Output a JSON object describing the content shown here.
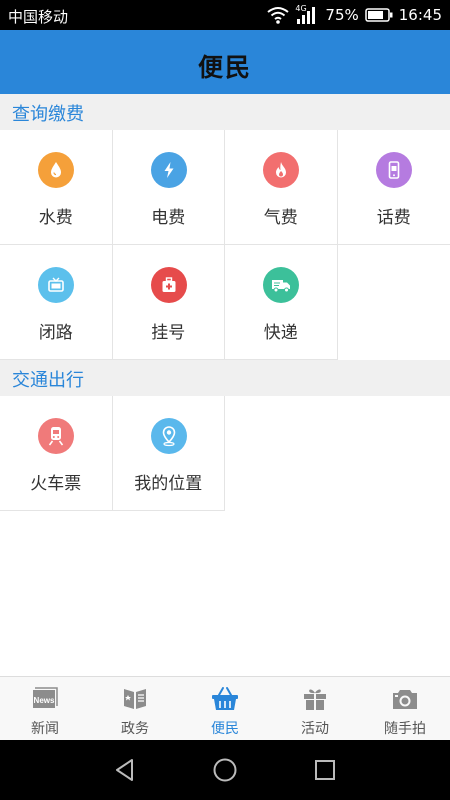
{
  "status_bar": {
    "carrier": "中国移动",
    "network": "4G",
    "battery": "75%",
    "battery_level": 0.75,
    "time": "16:45"
  },
  "header": {
    "title": "便民"
  },
  "sections": [
    {
      "title": "查询缴费",
      "items": [
        {
          "label": "水费",
          "icon": "water-drop-icon",
          "color": "#f5a03a"
        },
        {
          "label": "电费",
          "icon": "lightning-icon",
          "color": "#4aa3e4"
        },
        {
          "label": "气费",
          "icon": "flame-icon",
          "color": "#f26f6f"
        },
        {
          "label": "话费",
          "icon": "phone-icon",
          "color": "#b57be0"
        },
        {
          "label": "闭路",
          "icon": "tv-icon",
          "color": "#5cc0ec"
        },
        {
          "label": "挂号",
          "icon": "medical-kit-icon",
          "color": "#e64b4b"
        },
        {
          "label": "快递",
          "icon": "delivery-truck-icon",
          "color": "#3cc09a"
        }
      ]
    },
    {
      "title": "交通出行",
      "items": [
        {
          "label": "火车票",
          "icon": "train-icon",
          "color": "#f07a7a"
        },
        {
          "label": "我的位置",
          "icon": "location-pin-icon",
          "color": "#5ab8ec"
        }
      ]
    }
  ],
  "bottom_nav": [
    {
      "label": "新闻",
      "icon": "news-icon",
      "active": false
    },
    {
      "label": "政务",
      "icon": "government-book-icon",
      "active": false
    },
    {
      "label": "便民",
      "icon": "basket-icon",
      "active": true
    },
    {
      "label": "活动",
      "icon": "gift-icon",
      "active": false
    },
    {
      "label": "随手拍",
      "icon": "camera-icon",
      "active": false
    }
  ],
  "news_icon_text": "News",
  "colors": {
    "brand": "#2a86d9",
    "nav_inactive": "#9a9a9a"
  }
}
